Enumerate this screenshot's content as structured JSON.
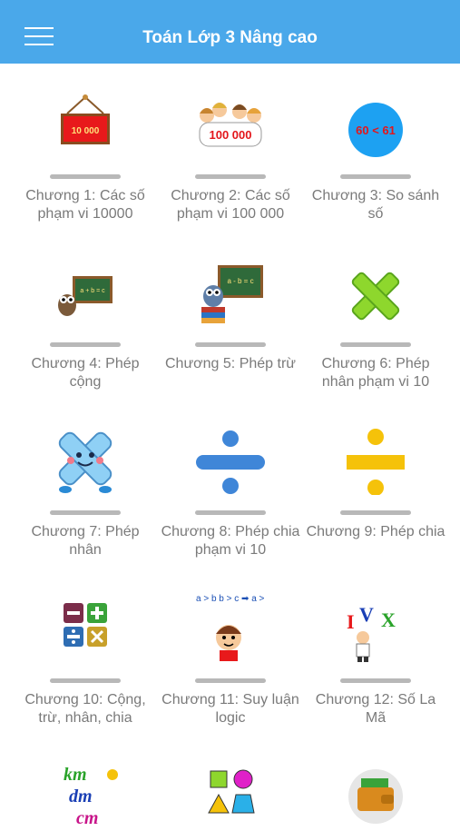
{
  "header": {
    "title": "Toán Lớp 3 Nâng cao",
    "bg_color": "#4aa8ea",
    "menu_icon": "hamburger-menu-icon"
  },
  "chapters": [
    {
      "label": "Chương 1: Các số phạm vi 10000",
      "icon": "sign-10000-icon",
      "icon_text": "10 000"
    },
    {
      "label": "Chương 2: Các số phạm vi 100 000",
      "icon": "kids-100000-sign-icon",
      "icon_text": "100 000"
    },
    {
      "label": "Chương 3: So sánh số",
      "icon": "compare-60-61-icon",
      "icon_text": "60 < 61"
    },
    {
      "label": "Chương 4: Phép cộng",
      "icon": "owl-board-plus-icon",
      "icon_text": "a + b = c"
    },
    {
      "label": "Chương 5: Phép trừ",
      "icon": "owl-board-minus-icon",
      "icon_text": "a - b = c"
    },
    {
      "label": "Chương 6: Phép nhân phạm vi 10",
      "icon": "green-times-icon"
    },
    {
      "label": "Chương 7: Phép nhân",
      "icon": "cartoon-times-icon"
    },
    {
      "label": "Chương 8: Phép chia phạm vi 10",
      "icon": "blue-divide-icon"
    },
    {
      "label": "Chương 9: Phép chia",
      "icon": "yellow-divide-icon"
    },
    {
      "label": "Chương 10: Cộng, trừ, nhân, chia",
      "icon": "four-operations-icon"
    },
    {
      "label": "Chương 11: Suy luận logic",
      "icon": "logic-boy-icon",
      "icon_text": "a > b b > c ➡ a > c"
    },
    {
      "label": "Chương 12: Số La Mã",
      "icon": "roman-numerals-icon",
      "icon_text": "I V X"
    },
    {
      "label": "",
      "icon": "km-dm-units-icon",
      "icon_text": "km dm cm"
    },
    {
      "label": "",
      "icon": "shapes-icon"
    },
    {
      "label": "",
      "icon": "wallet-money-icon"
    }
  ]
}
